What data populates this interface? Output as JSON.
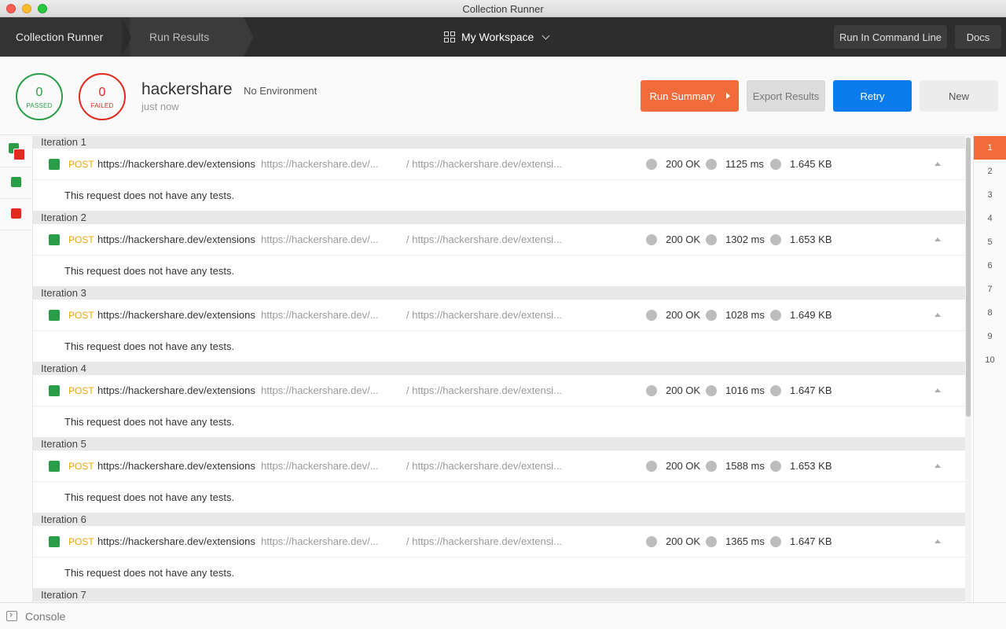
{
  "window": {
    "title": "Collection Runner"
  },
  "header": {
    "breadcrumb": [
      "Collection Runner",
      "Run Results"
    ],
    "workspace": "My Workspace",
    "cmdline_button": "Run In Command Line",
    "docs_button": "Docs"
  },
  "summary": {
    "passed": {
      "count": "0",
      "label": "PASSED"
    },
    "failed": {
      "count": "0",
      "label": "FAILED"
    },
    "collection": "hackershare",
    "environment": "No Environment",
    "time": "just now",
    "buttons": {
      "run_summary": "Run Summary",
      "export": "Export Results",
      "retry": "Retry",
      "new": "New"
    }
  },
  "iterations": [
    {
      "label": "Iteration 1",
      "method": "POST",
      "name": "https://hackershare.dev/extensions",
      "url": "https://hackershare.dev/...",
      "path": "/ https://hackershare.dev/extensi...",
      "code": "200 OK",
      "time": "1125 ms",
      "size": "1.645 KB",
      "tests": "This request does not have any tests."
    },
    {
      "label": "Iteration 2",
      "method": "POST",
      "name": "https://hackershare.dev/extensions",
      "url": "https://hackershare.dev/...",
      "path": "/ https://hackershare.dev/extensi...",
      "code": "200 OK",
      "time": "1302 ms",
      "size": "1.653 KB",
      "tests": "This request does not have any tests."
    },
    {
      "label": "Iteration 3",
      "method": "POST",
      "name": "https://hackershare.dev/extensions",
      "url": "https://hackershare.dev/...",
      "path": "/ https://hackershare.dev/extensi...",
      "code": "200 OK",
      "time": "1028 ms",
      "size": "1.649 KB",
      "tests": "This request does not have any tests."
    },
    {
      "label": "Iteration 4",
      "method": "POST",
      "name": "https://hackershare.dev/extensions",
      "url": "https://hackershare.dev/...",
      "path": "/ https://hackershare.dev/extensi...",
      "code": "200 OK",
      "time": "1016 ms",
      "size": "1.647 KB",
      "tests": "This request does not have any tests."
    },
    {
      "label": "Iteration 5",
      "method": "POST",
      "name": "https://hackershare.dev/extensions",
      "url": "https://hackershare.dev/...",
      "path": "/ https://hackershare.dev/extensi...",
      "code": "200 OK",
      "time": "1588 ms",
      "size": "1.653 KB",
      "tests": "This request does not have any tests."
    },
    {
      "label": "Iteration 6",
      "method": "POST",
      "name": "https://hackershare.dev/extensions",
      "url": "https://hackershare.dev/...",
      "path": "/ https://hackershare.dev/extensi...",
      "code": "200 OK",
      "time": "1365 ms",
      "size": "1.647 KB",
      "tests": "This request does not have any tests."
    },
    {
      "label": "Iteration 7"
    }
  ],
  "rail": [
    "1",
    "2",
    "3",
    "4",
    "5",
    "6",
    "7",
    "8",
    "9",
    "10"
  ],
  "footer": {
    "console": "Console"
  },
  "colors": {
    "accent": "#f26b3a",
    "primary": "#097bed",
    "pass": "#2a9d47",
    "fail": "#e2291d",
    "method": "#e9a500"
  },
  "icons": [
    "grid-icon",
    "chevron-down-icon",
    "play-triangle-icon",
    "status-square-icon",
    "status-dot-icon",
    "collapse-caret-icon",
    "console-icon"
  ]
}
